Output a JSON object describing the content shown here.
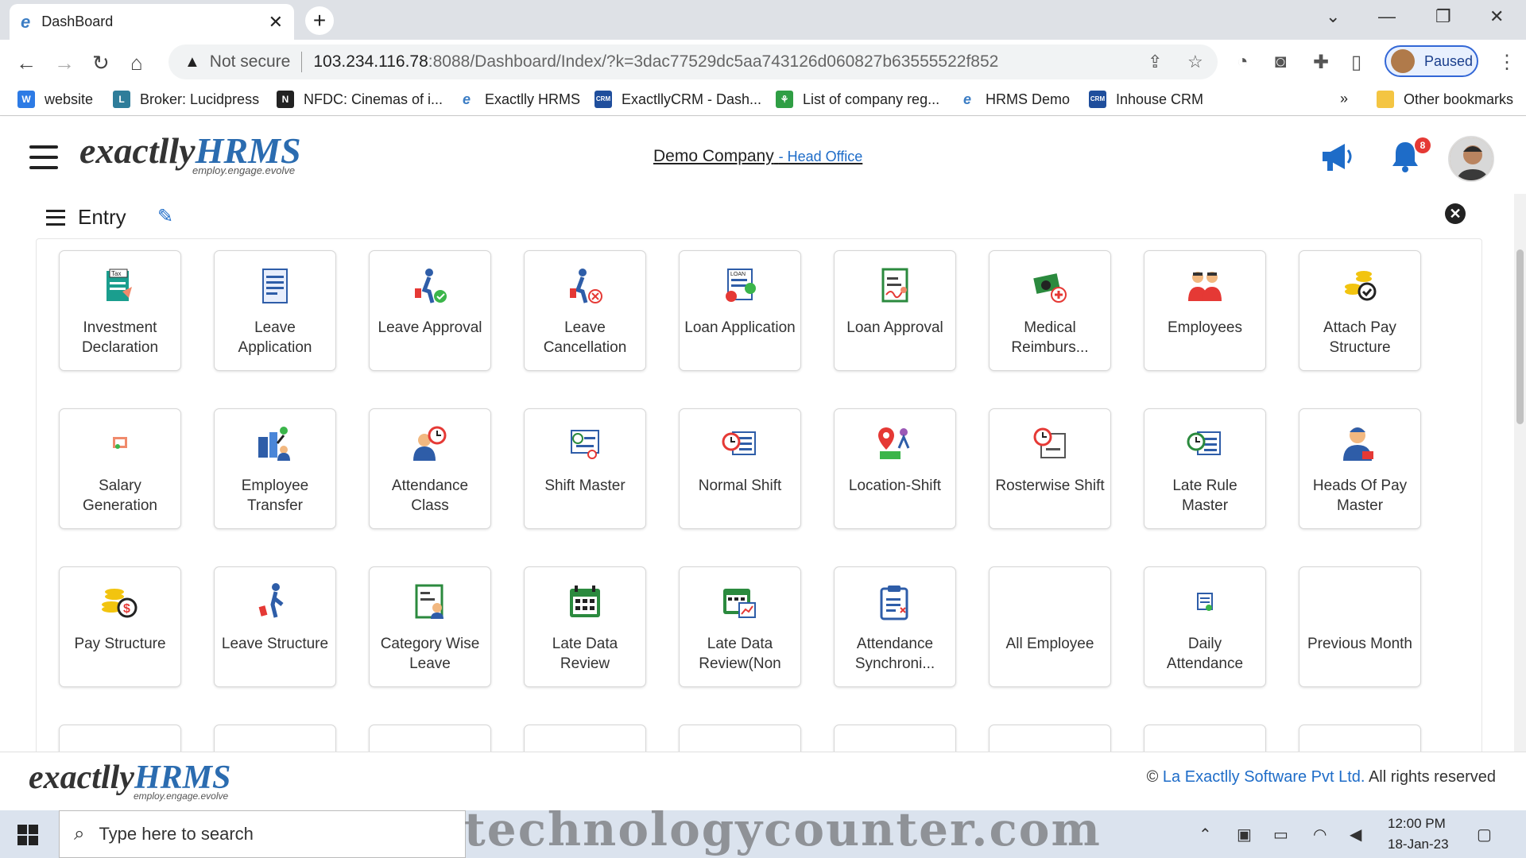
{
  "browser": {
    "tab_title": "DashBoard",
    "not_secure": "Not secure",
    "url_host": "103.234.116.78",
    "url_rest": ":8088/Dashboard/Index/?k=3dac77529dc5aa743126d060827b63555522f852",
    "profile_status": "Paused",
    "bookmarks": [
      {
        "label": "website",
        "color": "#2d7be5"
      },
      {
        "label": "Broker: Lucidpress",
        "color": "#2e7d9a"
      },
      {
        "label": "NFDC: Cinemas of i...",
        "color": "#222222"
      },
      {
        "label": "Exactlly HRMS",
        "color": "#3b7dc4"
      },
      {
        "label": "ExactllyCRM - Dash...",
        "color": "#1f4e9c"
      },
      {
        "label": "List of company reg...",
        "color": "#2f9e44"
      },
      {
        "label": "HRMS Demo",
        "color": "#3b7dc4"
      },
      {
        "label": "Inhouse CRM",
        "color": "#1f4e9c"
      }
    ],
    "other_bookmarks": "Other bookmarks",
    "more": "»"
  },
  "header": {
    "logo_main": "exactlly",
    "logo_hrms": "HRMS",
    "logo_tagline": "employ.engage.evolve",
    "company": "Demo Company",
    "branch": "- Head Office",
    "notification_count": "8"
  },
  "entry": {
    "title": "Entry"
  },
  "tiles": [
    {
      "label": "Investment Declaration",
      "icon": "tax-form-icon"
    },
    {
      "label": "Leave Application",
      "icon": "document-icon"
    },
    {
      "label": "Leave Approval",
      "icon": "traveler-check-icon"
    },
    {
      "label": "Leave Cancellation",
      "icon": "traveler-cross-icon"
    },
    {
      "label": "Loan Application",
      "icon": "loan-form-icon"
    },
    {
      "label": "Loan Approval",
      "icon": "signed-form-icon"
    },
    {
      "label": "Medical Reimburs...",
      "icon": "medical-money-icon"
    },
    {
      "label": "Employees",
      "icon": "employees-icon"
    },
    {
      "label": "Attach Pay Structure",
      "icon": "coins-check-icon"
    },
    {
      "label": "Salary Generation",
      "icon": "salary-icon"
    },
    {
      "label": "Employee Transfer",
      "icon": "transfer-icon"
    },
    {
      "label": "Attendance Class",
      "icon": "person-clock-icon"
    },
    {
      "label": "Shift Master",
      "icon": "shift-clock-icon"
    },
    {
      "label": "Normal Shift",
      "icon": "clock-list-icon"
    },
    {
      "label": "Location-Shift",
      "icon": "location-shift-icon"
    },
    {
      "label": "Rosterwise Shift",
      "icon": "roster-clock-icon"
    },
    {
      "label": "Late Rule Master",
      "icon": "late-rule-icon"
    },
    {
      "label": "Heads Of Pay Master",
      "icon": "pay-head-icon"
    },
    {
      "label": "Pay Structure",
      "icon": "coins-dollar-icon"
    },
    {
      "label": "Leave Structure",
      "icon": "walker-icon"
    },
    {
      "label": "Category Wise Leave",
      "icon": "category-leave-icon"
    },
    {
      "label": "Late Data Review",
      "icon": "calendar-icon"
    },
    {
      "label": "Late Data Review(Non",
      "icon": "calendar-chart-icon"
    },
    {
      "label": "Attendance Synchroni...",
      "icon": "clipboard-icon"
    },
    {
      "label": "All Employee",
      "icon": ""
    },
    {
      "label": "Daily Attendance",
      "icon": "small-form-icon"
    },
    {
      "label": "Previous Month",
      "icon": ""
    }
  ],
  "footer": {
    "copyright_symbol": "©",
    "company_link": "La Exactlly Software Pvt Ltd.",
    "rights": "All rights reserved"
  },
  "taskbar": {
    "search_placeholder": "Type here to search",
    "watermark": "technologycounter.com",
    "time": "12:00 PM",
    "date": "18-Jan-23"
  },
  "colors": {
    "accent_blue": "#1e6cc8",
    "badge_red": "#e53935"
  }
}
